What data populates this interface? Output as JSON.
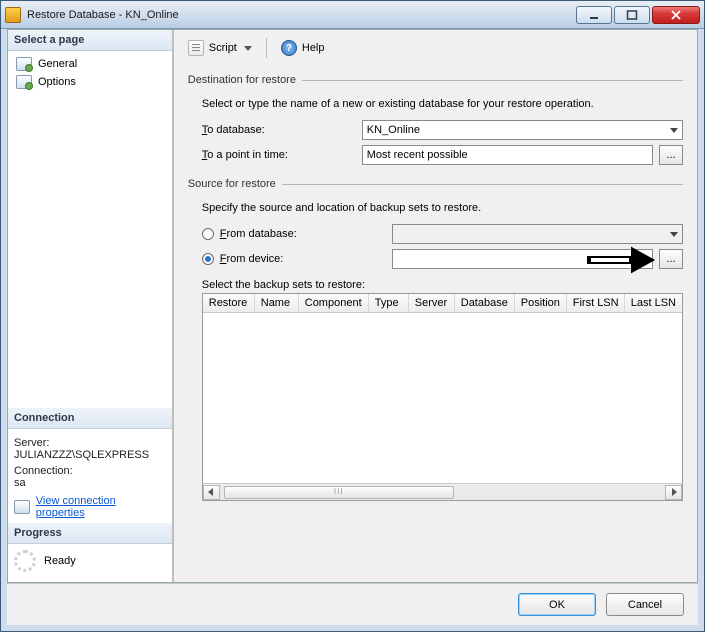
{
  "window": {
    "title": "Restore Database - KN_Online"
  },
  "titlebar_controls": {
    "minimize": "Minimize",
    "maximize": "Maximize",
    "close": "Close"
  },
  "left_panel": {
    "select_page_header": "Select a page",
    "pages": [
      {
        "label": "General"
      },
      {
        "label": "Options"
      }
    ],
    "connection_header": "Connection",
    "server_label": "Server:",
    "server_value": "JULIANZZZ\\SQLEXPRESS",
    "connection_label": "Connection:",
    "connection_value": "sa",
    "view_connection_props": "View connection properties",
    "progress_header": "Progress",
    "progress_status": "Ready"
  },
  "toolbar": {
    "script_label": "Script",
    "help_label": "Help"
  },
  "destination": {
    "legend": "Destination for restore",
    "description": "Select or type the name of a new or existing database for your restore operation.",
    "to_database_label_prefix": "T",
    "to_database_label_rest": "o database:",
    "to_database_value": "KN_Online",
    "to_point_label_prefix": "T",
    "to_point_label_rest": "o a point in time:",
    "to_point_value": "Most recent possible",
    "ellipsis": "..."
  },
  "source": {
    "legend": "Source for restore",
    "description": "Specify the source and location of backup sets to restore.",
    "from_database_prefix": "F",
    "from_database_rest": "rom database:",
    "from_database_value": "",
    "from_device_prefix": "F",
    "from_device_rest": "rom device:",
    "from_device_value": "",
    "ellipsis": "...",
    "from_selected": "device",
    "grid_label": "Select the backup sets to restore:",
    "columns": [
      "Restore",
      "Name",
      "Component",
      "Type",
      "Server",
      "Database",
      "Position",
      "First LSN",
      "Last LSN"
    ]
  },
  "footer": {
    "ok": "OK",
    "cancel": "Cancel"
  }
}
